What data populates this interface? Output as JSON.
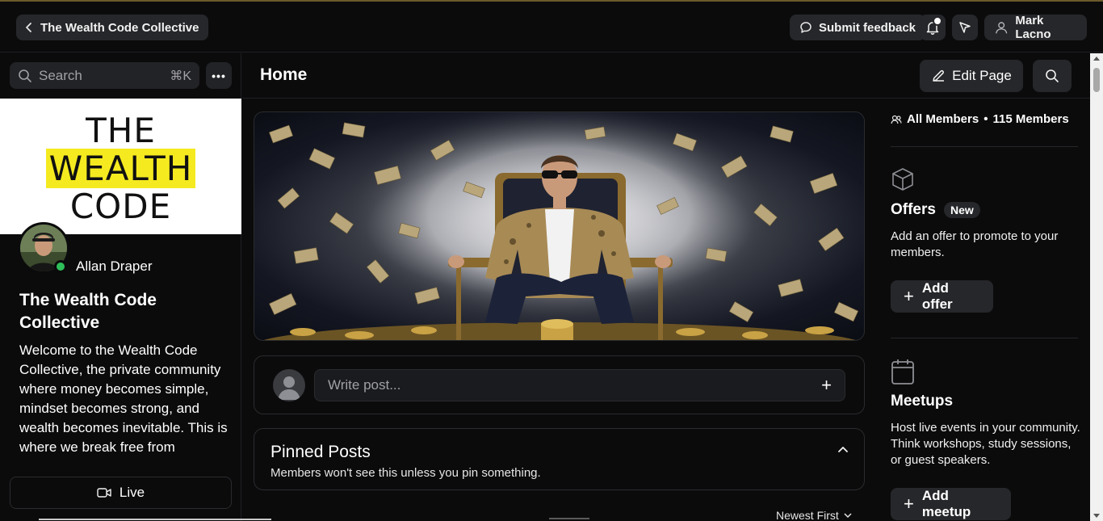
{
  "topbar": {
    "community_name": "The Wealth Code Collective",
    "feedback_label": "Submit feedback",
    "user_name": "Mark Lacno"
  },
  "sidebar": {
    "search_placeholder": "Search",
    "search_shortcut": "⌘K",
    "banner_line1": "THE",
    "banner_line2": "WEALTH",
    "banner_line3": "CODE",
    "owner_name": "Allan Draper",
    "community_title": "The Wealth Code Collective",
    "description": "Welcome to the Wealth Code Collective, the private community where money becomes simple, mindset becomes strong, and wealth becomes inevitable. This is where we break free from",
    "live_label": "Live"
  },
  "main": {
    "page_title": "Home",
    "edit_label": "Edit Page",
    "write_placeholder": "Write post...",
    "pinned_title": "Pinned Posts",
    "pinned_subtitle": "Members won't see this unless you pin something.",
    "sort_label": "Newest First"
  },
  "right": {
    "all_members": "All Members",
    "members_count": "115 Members",
    "offers_title": "Offers",
    "offers_badge": "New",
    "offers_desc": "Add an offer to promote to your members.",
    "add_offer": "Add offer",
    "meetups_title": "Meetups",
    "meetups_desc": "Host live events in your community. Think workshops, study sessions, or guest speakers.",
    "add_meetup": "Add meetup"
  },
  "colors": {
    "background": "#0b0b0c",
    "pill": "#26272a",
    "online": "#2fbf5a",
    "banner_highlight": "#f5ea1f"
  }
}
